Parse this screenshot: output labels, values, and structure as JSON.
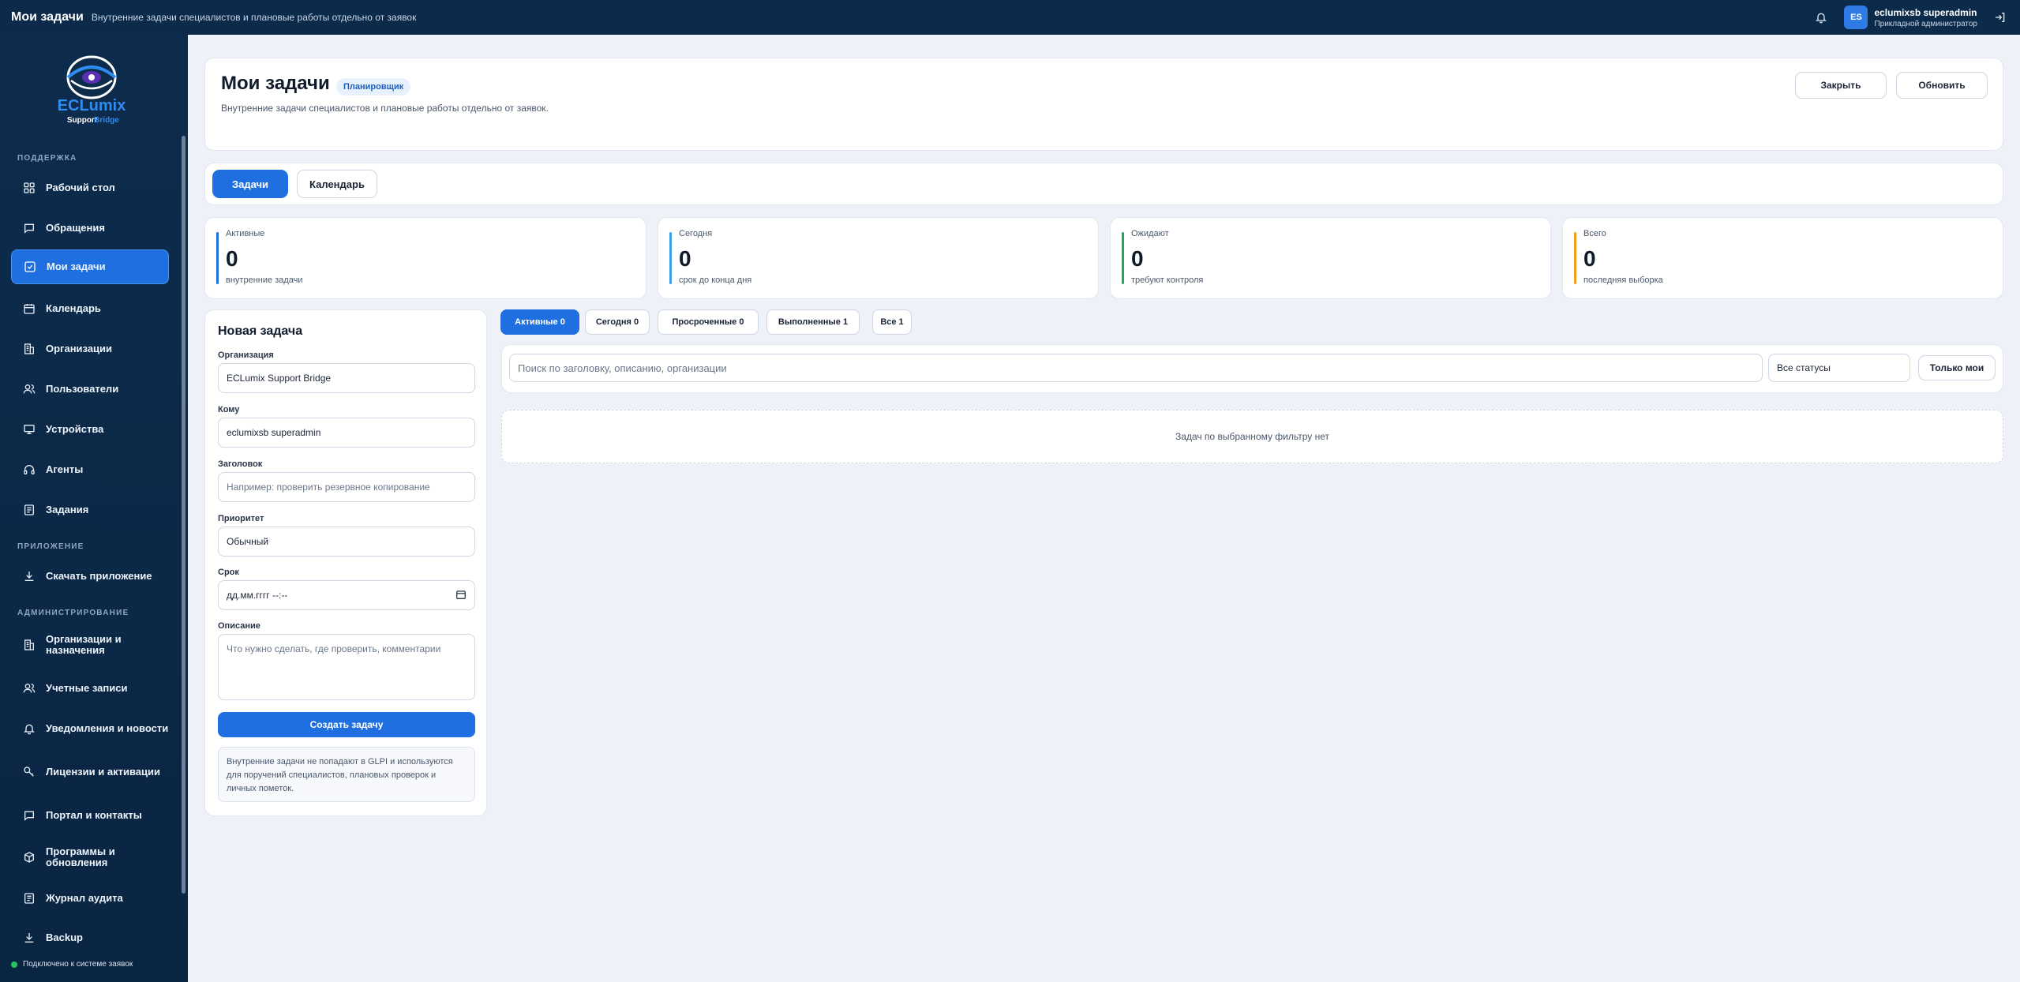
{
  "topbar": {
    "title": "Мои задачи",
    "subtitle": "Внутренние задачи специалистов и плановые работы отдельно от заявок",
    "user": {
      "initials": "ES",
      "name": "eclumixsb superadmin",
      "role": "Прикладной администратор"
    },
    "icons": [
      "bell-icon",
      "logout-icon"
    ]
  },
  "sidebar": {
    "logo": {
      "brand": "ECLumix",
      "sub1": "Support",
      "sub2": "Bridge"
    },
    "sections": {
      "support": "ПОДДЕРЖКА",
      "app": "ПРИЛОЖЕНИЕ",
      "admin": "АДМИНИСТРИРОВАНИЕ"
    },
    "items": [
      {
        "label": "Рабочий стол",
        "icon": "grid-icon"
      },
      {
        "label": "Обращения",
        "icon": "chat-icon"
      },
      {
        "label": "Мои задачи",
        "icon": "checkbox-icon",
        "active": true
      },
      {
        "label": "Календарь",
        "icon": "calendar-icon"
      },
      {
        "label": "Организации",
        "icon": "building-icon"
      },
      {
        "label": "Пользователи",
        "icon": "users-icon"
      },
      {
        "label": "Устройства",
        "icon": "monitor-icon"
      },
      {
        "label": "Агенты",
        "icon": "headset-icon"
      },
      {
        "label": "Задания",
        "icon": "list-icon"
      },
      {
        "label": "Скачать приложение",
        "icon": "download-icon"
      },
      {
        "label": "Организации и назначения",
        "icon": "building-icon"
      },
      {
        "label": "Учетные записи",
        "icon": "users-icon"
      },
      {
        "label": "Уведомления и новости",
        "icon": "bell-icon"
      },
      {
        "label": "Лицензии и активации",
        "icon": "key-icon"
      },
      {
        "label": "Портал и контакты",
        "icon": "chat-icon"
      },
      {
        "label": "Программы и обновления",
        "icon": "box-icon"
      },
      {
        "label": "Журнал аудита",
        "icon": "doc-icon"
      },
      {
        "label": "Backup",
        "icon": "download-icon"
      }
    ],
    "status": "Подключено к системе заявок",
    "colors": {
      "bg": "#0c2a4a",
      "active": "#1f6fe0"
    }
  },
  "header": {
    "title": "Мои задачи",
    "badge": "Планировщик",
    "subtitle": "Внутренние задачи специалистов и плановые работы отдельно от заявок.",
    "close_label": "Закрыть",
    "refresh_label": "Обновить"
  },
  "tabs": [
    {
      "label": "Задачи",
      "active": true
    },
    {
      "label": "Календарь",
      "active": false
    }
  ],
  "stats": [
    {
      "label": "Активные",
      "value": "0",
      "note": "внутренние задачи",
      "color": "#1f6fe0"
    },
    {
      "label": "Сегодня",
      "value": "0",
      "note": "срок до конца дня",
      "color": "#3ba0e6"
    },
    {
      "label": "Ожидают",
      "value": "0",
      "note": "требуют контроля",
      "color": "#22a55e"
    },
    {
      "label": "Всего",
      "value": "0",
      "note": "последняя выборка",
      "color": "#f0a020"
    }
  ],
  "form": {
    "title": "Новая задача",
    "org_label": "Организация",
    "org_value": "ECLumix Support Bridge",
    "to_label": "Кому",
    "to_value": "eclumixsb superadmin",
    "subject_label": "Заголовок",
    "subject_placeholder": "Например: проверить резервное копирование",
    "priority_label": "Приоритет",
    "priority_value": "Обычный",
    "due_label": "Срок",
    "due_placeholder": "дд.мм.гггг --:--",
    "desc_label": "Описание",
    "desc_placeholder": "Что нужно сделать, где проверить, комментарии",
    "submit_label": "Создать задачу",
    "note": "Внутренние задачи не попадают в GLPI и используются для поручений специалистов, плановых проверок и личных пометок."
  },
  "filters": [
    {
      "label": "Активные 0",
      "active": true
    },
    {
      "label": "Сегодня 0",
      "active": false
    },
    {
      "label": "Просроченные 0",
      "active": false
    },
    {
      "label": "Выполненные 1",
      "active": false
    },
    {
      "label": "Все 1",
      "active": false
    }
  ],
  "list": {
    "search_placeholder": "Поиск по заголовку, описанию, организации",
    "status_value": "Все статусы",
    "only_mine_label": "Только мои",
    "empty_text": "Задач по выбранному фильтру нет"
  }
}
